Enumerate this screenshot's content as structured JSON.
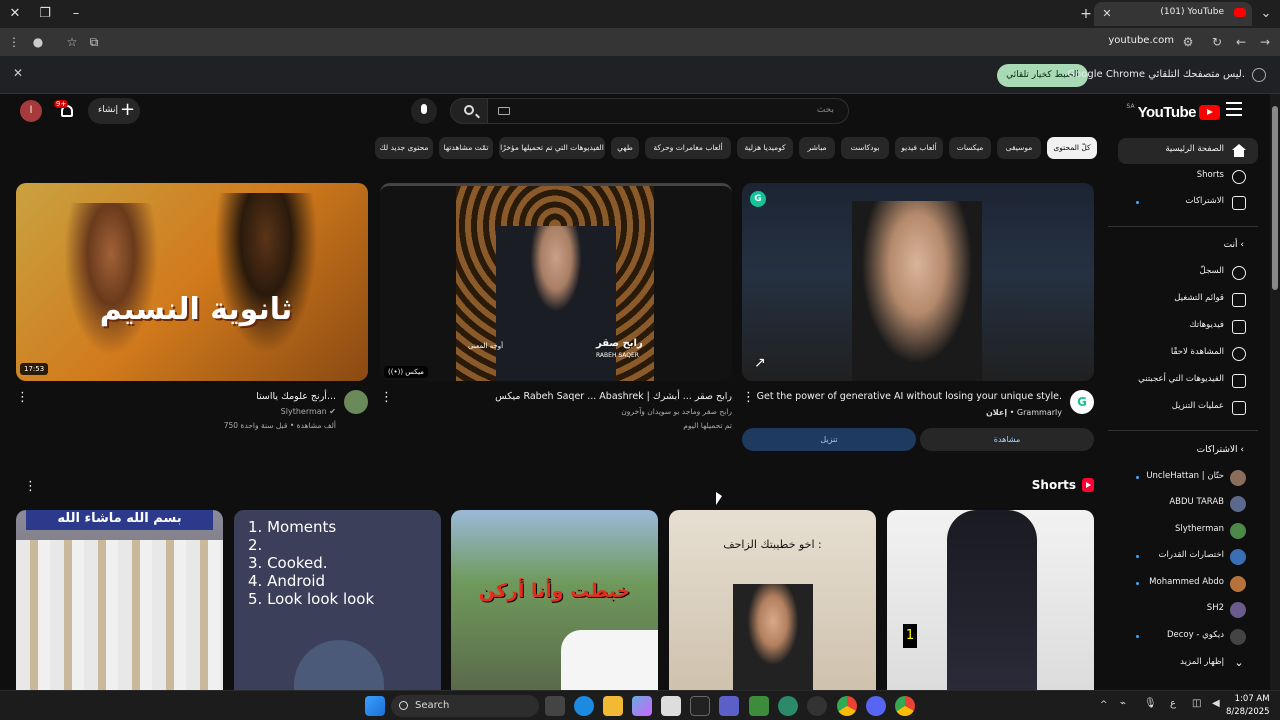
{
  "browser": {
    "tab_title": "(101) YouTube",
    "url": "youtube.com",
    "infobar_message": "Google Chrome ليس متصفحك التلقائي.",
    "infobar_button": "الضبط كخيار تلقائي"
  },
  "header": {
    "logo": "YouTube",
    "logo_region": "SA",
    "search_placeholder": "بحث",
    "create_label": "إنشاء",
    "notification_count": "9+",
    "avatar_letter": "ا"
  },
  "sidebar": {
    "main": [
      {
        "label": "الصفحة الرئيسية",
        "icon": "home-icon"
      },
      {
        "label": "Shorts",
        "icon": "shorts-icon"
      },
      {
        "label": "الاشتراكات",
        "icon": "subscriptions-icon"
      }
    ],
    "you_heading": "أنت",
    "you": [
      {
        "label": "السجلّ",
        "icon": "history-icon"
      },
      {
        "label": "قوائم التشغيل",
        "icon": "playlists-icon"
      },
      {
        "label": "فيديوهاتك",
        "icon": "your-videos-icon"
      },
      {
        "label": "المشاهدة لاحقًا",
        "icon": "watch-later-icon"
      },
      {
        "label": "الفيديوهات التي أعجبتني",
        "icon": "like-icon"
      },
      {
        "label": "عمليات التنزيل",
        "icon": "download-icon"
      }
    ],
    "subs_heading": "الاشتراكات",
    "subs": [
      {
        "label": "UncleHattan | حتّان",
        "color": "#8a6d5c"
      },
      {
        "label": "ABDU TARAB",
        "color": "#5b6a8c"
      },
      {
        "label": "Slytherman",
        "color": "#4d8a4a"
      },
      {
        "label": "اختصارات القدرات",
        "color": "#3b6fb5"
      },
      {
        "label": "Mohammed Abdo",
        "color": "#b5733b"
      },
      {
        "label": "SH2",
        "color": "#6a5b8c"
      },
      {
        "label": "Decoy - ديكوي",
        "color": "#444444"
      }
    ],
    "show_more": "إظهار المزيد"
  },
  "chips": [
    "كلّ المحتوى",
    "موسيقى",
    "ميكسات",
    "ألعاب فيديو",
    "بودكاست",
    "مباشر",
    "كوميديا هزلية",
    "ألعاب مغامرات وحركة",
    "طهي",
    "الفيديوهات التي تم تحميلها مؤخرًا",
    "تمّت مشاهدتها",
    "محتوى جديد لك"
  ],
  "videos": [
    {
      "title": "Get the power of generative AI without losing your unique style.",
      "channel": "Grammarly",
      "meta": "إعلان",
      "cta_left": "تنزيل",
      "cta_right": "مشاهدة"
    },
    {
      "title": "ميكس Rabeh Saqer ... Abashrek | رابح صقر ... أبشرك",
      "channel": "رابح صقر وماجد بو سويدان وآخرون",
      "meta": "تم تحميلها اليوم",
      "badge": "ميكس",
      "thumb_text": "رابح صقر",
      "thumb_text2": "RABEH SAQER",
      "thumb_text3": "أوجه المعنى"
    },
    {
      "title": "أرنج علومك يااستا...",
      "channel": "Slytherman",
      "meta": "750 ألف مشاهدة • قبل سنة واحدة",
      "duration": "17:53",
      "thumb_text": "ثانوية النسيم"
    }
  ],
  "shorts_heading": "Shorts",
  "shorts": [
    {
      "text": "",
      "bg": "#7a5a3c"
    },
    {
      "text": "خبطت وأنا أركن",
      "bg": "#6f8a5c"
    },
    {
      "text": "1. Moments\n2.\n3. Cooked.\n4. Android\n5. Look look look",
      "bg": "#3b3f5a"
    },
    {
      "text": "اخو خطيبتك الزاحف :",
      "bg": "#c8b89a"
    },
    {
      "text": "بسم الله ماشاء الله",
      "bg": "#5a6b7c"
    }
  ],
  "taskbar": {
    "search_label": "Search",
    "time": "1:07 AM",
    "date": "8/28/2025"
  }
}
